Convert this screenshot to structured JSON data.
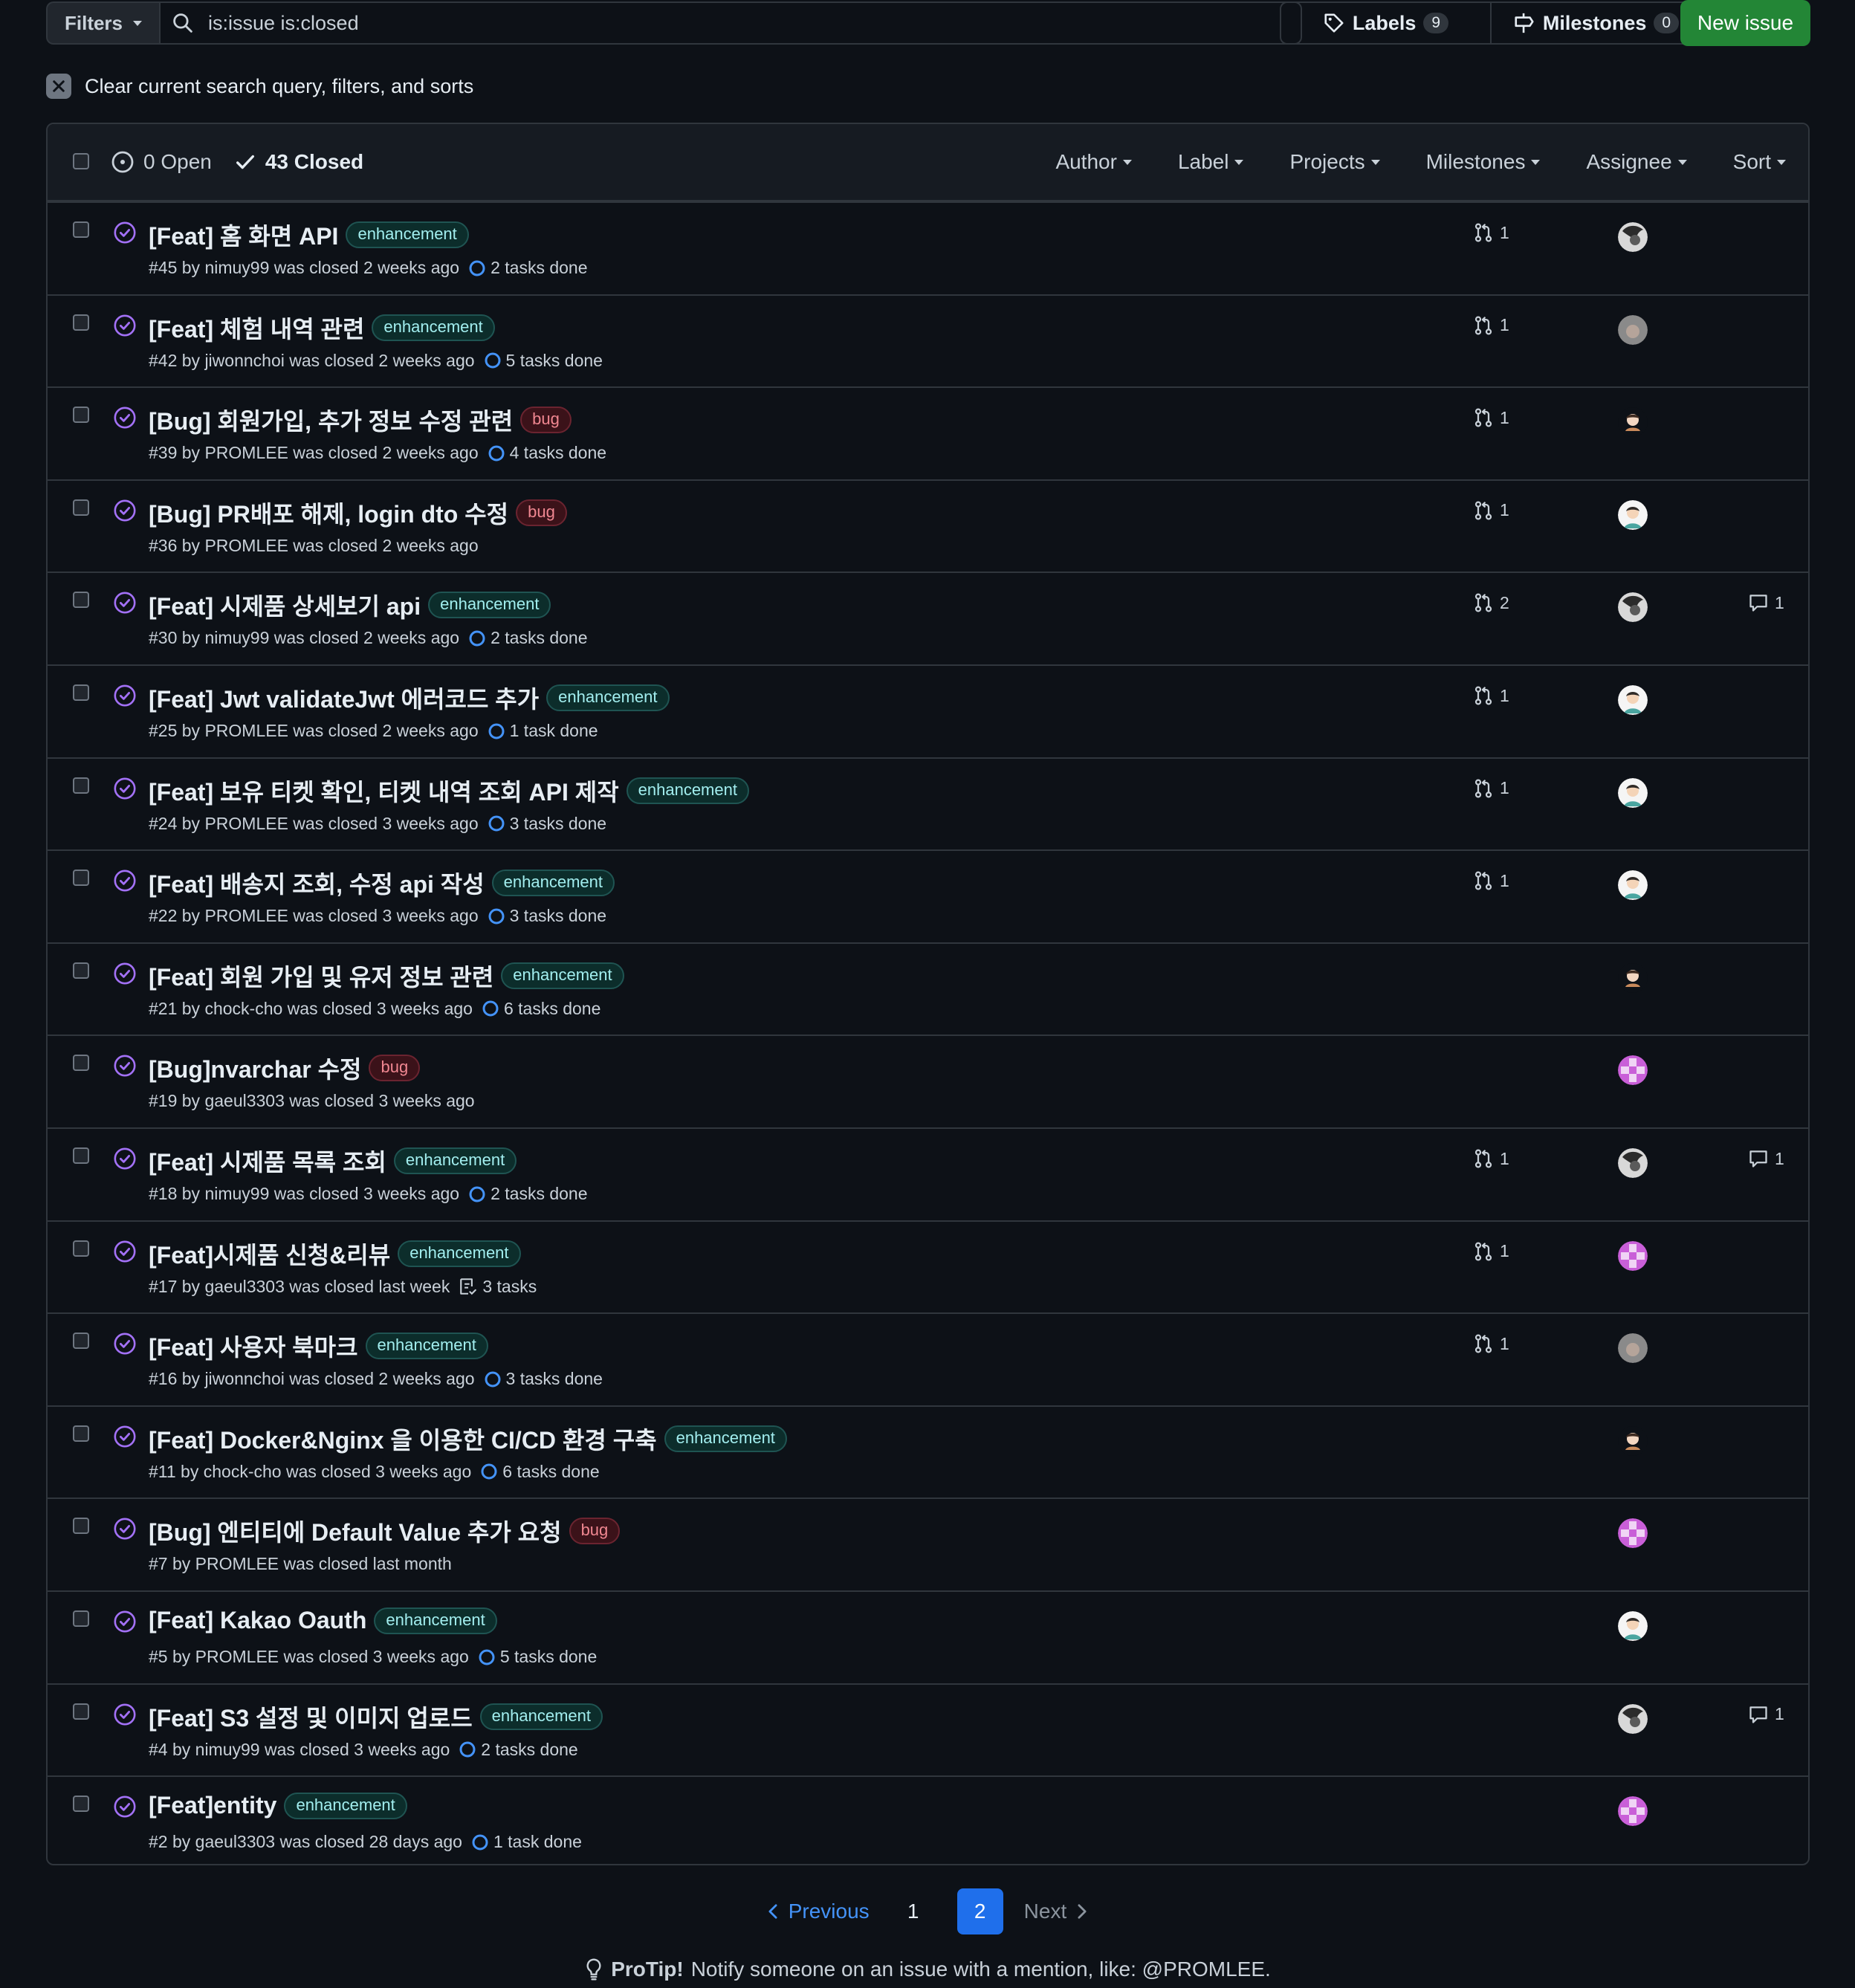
{
  "toolbar": {
    "filters_label": "Filters",
    "search_value": "is:issue is:closed",
    "labels_label": "Labels",
    "labels_count": "9",
    "milestones_label": "Milestones",
    "milestones_count": "0",
    "new_issue_label": "New issue"
  },
  "clear_text": "Clear current search query, filters, and sorts",
  "header": {
    "open_label": "0 Open",
    "closed_label": "43 Closed",
    "menus": [
      "Author",
      "Label",
      "Projects",
      "Milestones",
      "Assignee",
      "Sort"
    ]
  },
  "issues": [
    {
      "title": "[Feat] 홈 화면 API",
      "label": "enhancement",
      "meta": "#45 by nimuy99 was closed 2 weeks ago",
      "tasks": "2 tasks done",
      "pr": "1",
      "comments": "",
      "avatar": "nimuy99"
    },
    {
      "title": "[Feat] 체험 내역 관련",
      "label": "enhancement",
      "meta": "#42 by jiwonnchoi was closed 2 weeks ago",
      "tasks": "5 tasks done",
      "pr": "1",
      "comments": "",
      "avatar": "jiwonnchoi"
    },
    {
      "title": "[Bug] 회원가입, 추가 정보 수정 관련",
      "label": "bug",
      "meta": "#39 by PROMLEE was closed 2 weeks ago",
      "tasks": "4 tasks done",
      "pr": "1",
      "comments": "",
      "avatar": "chock-cho"
    },
    {
      "title": "[Bug] PR배포 해제, login dto 수정",
      "label": "bug",
      "meta": "#36 by PROMLEE was closed 2 weeks ago",
      "tasks": "",
      "pr": "1",
      "comments": "",
      "avatar": "PROMLEE"
    },
    {
      "title": "[Feat] 시제품 상세보기 api",
      "label": "enhancement",
      "meta": "#30 by nimuy99 was closed 2 weeks ago",
      "tasks": "2 tasks done",
      "pr": "2",
      "comments": "1",
      "avatar": "nimuy99"
    },
    {
      "title": "[Feat] Jwt validateJwt 에러코드 추가",
      "label": "enhancement",
      "meta": "#25 by PROMLEE was closed 2 weeks ago",
      "tasks": "1 task done",
      "pr": "1",
      "comments": "",
      "avatar": "PROMLEE"
    },
    {
      "title": "[Feat] 보유 티켓 확인, 티켓 내역 조회 API 제작",
      "label": "enhancement",
      "meta": "#24 by PROMLEE was closed 3 weeks ago",
      "tasks": "3 tasks done",
      "pr": "1",
      "comments": "",
      "avatar": "PROMLEE"
    },
    {
      "title": "[Feat] 배송지 조회, 수정 api 작성",
      "label": "enhancement",
      "meta": "#22 by PROMLEE was closed 3 weeks ago",
      "tasks": "3 tasks done",
      "pr": "1",
      "comments": "",
      "avatar": "PROMLEE"
    },
    {
      "title": "[Feat] 회원 가입 및 유저 정보 관련",
      "label": "enhancement",
      "meta": "#21 by chock-cho was closed 3 weeks ago",
      "tasks": "6 tasks done",
      "pr": "",
      "comments": "",
      "avatar": "chock-cho"
    },
    {
      "title": "[Bug]nvarchar 수정",
      "label": "bug",
      "meta": "#19 by gaeul3303 was closed 3 weeks ago",
      "tasks": "",
      "pr": "",
      "comments": "",
      "avatar": "gaeul3303"
    },
    {
      "title": "[Feat] 시제품 목록 조회",
      "label": "enhancement",
      "meta": "#18 by nimuy99 was closed 3 weeks ago",
      "tasks": "2 tasks done",
      "pr": "1",
      "comments": "1",
      "avatar": "nimuy99"
    },
    {
      "title": "[Feat]시제품 신청&리뷰",
      "label": "enhancement",
      "meta": "#17 by gaeul3303 was closed last week",
      "tasks": "3 tasks",
      "tasks_type": "list",
      "pr": "1",
      "comments": "",
      "avatar": "gaeul3303"
    },
    {
      "title": "[Feat] 사용자 북마크",
      "label": "enhancement",
      "meta": "#16 by jiwonnchoi was closed 2 weeks ago",
      "tasks": "3 tasks done",
      "pr": "1",
      "comments": "",
      "avatar": "jiwonnchoi"
    },
    {
      "title": "[Feat] Docker&Nginx 을 이용한 CI/CD 환경 구축",
      "label": "enhancement",
      "meta": "#11 by chock-cho was closed 3 weeks ago",
      "tasks": "6 tasks done",
      "pr": "",
      "comments": "",
      "avatar": "chock-cho"
    },
    {
      "title": "[Bug] 엔티티에 Default Value 추가 요청",
      "label": "bug",
      "meta": "#7 by PROMLEE was closed last month",
      "tasks": "",
      "pr": "",
      "comments": "",
      "avatar": "gaeul3303"
    },
    {
      "title": "[Feat] Kakao Oauth",
      "label": "enhancement",
      "meta": "#5 by PROMLEE was closed 3 weeks ago",
      "tasks": "5 tasks done",
      "pr": "",
      "comments": "",
      "avatar": "PROMLEE"
    },
    {
      "title": "[Feat] S3 설정 및 이미지 업로드",
      "label": "enhancement",
      "meta": "#4 by nimuy99 was closed 3 weeks ago",
      "tasks": "2 tasks done",
      "pr": "",
      "comments": "1",
      "avatar": "nimuy99"
    },
    {
      "title": "[Feat]entity",
      "label": "enhancement",
      "meta": "#2 by gaeul3303 was closed 28 days ago",
      "tasks": "1 task done",
      "pr": "",
      "comments": "",
      "avatar": "gaeul3303"
    }
  ],
  "pagination": {
    "previous_label": "Previous",
    "pages": [
      "1",
      "2"
    ],
    "current": "2",
    "next_label": "Next"
  },
  "protip": {
    "bold": "ProTip!",
    "text": "Notify someone on an issue with a mention, like: @PROMLEE."
  },
  "colors": {
    "closed_icon": "#a371f7",
    "accent": "#1f6feb",
    "new_issue_bg": "#238636"
  }
}
